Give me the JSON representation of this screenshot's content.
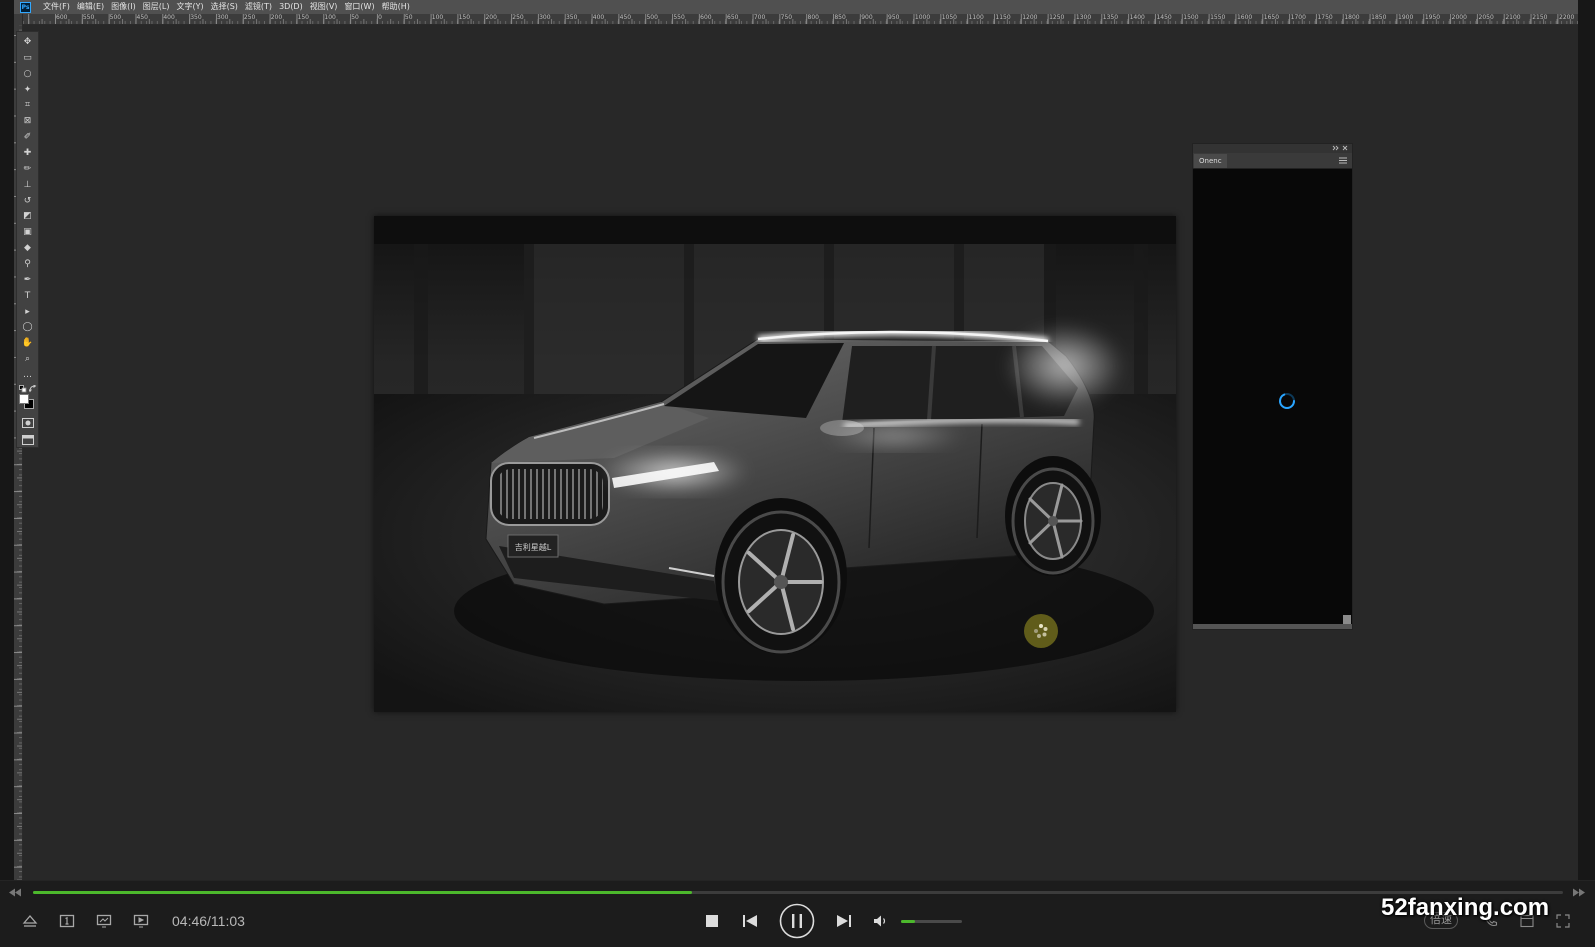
{
  "menu": {
    "logo": "Ps",
    "items": [
      "文件(F)",
      "编辑(E)",
      "图像(I)",
      "图层(L)",
      "文字(Y)",
      "选择(S)",
      "滤镜(T)",
      "3D(D)",
      "视图(V)",
      "窗口(W)",
      "帮助(H)"
    ]
  },
  "ruler": {
    "labels": [
      "600",
      "550",
      "500",
      "450",
      "400",
      "350",
      "300",
      "250",
      "200",
      "150",
      "100",
      "50",
      "0",
      "50",
      "100",
      "150",
      "200",
      "250",
      "300",
      "350",
      "400",
      "450",
      "500",
      "550",
      "600",
      "650",
      "700",
      "750",
      "800",
      "850",
      "900",
      "950",
      "1000",
      "1050",
      "1100",
      "1150",
      "1200",
      "1250",
      "1300",
      "1350",
      "1400",
      "1450",
      "1500",
      "1550",
      "1600",
      "1650",
      "1700",
      "1750",
      "1800",
      "1850",
      "1900",
      "1950",
      "2000",
      "2050",
      "2100",
      "2150",
      "2200"
    ]
  },
  "toolbar": {
    "tools": [
      "move",
      "rectangular-marquee",
      "lasso",
      "magic-wand",
      "crop",
      "frame",
      "eyedropper",
      "healing-brush",
      "brush",
      "clone-stamp",
      "history-brush",
      "eraser",
      "gradient",
      "blur",
      "dodge",
      "pen",
      "type",
      "path-selection",
      "ellipse",
      "hand",
      "zoom",
      "more"
    ],
    "foreground_color": "#ffffff",
    "background_color": "#000000"
  },
  "canvas": {
    "plate_text": "吉利星越L"
  },
  "panel": {
    "tab_label": "Onenc",
    "spinner_color": "#2aa5ff"
  },
  "player": {
    "time": "04:46/11:03",
    "progress_fraction": 0.431,
    "volume_fraction": 0.23,
    "speed_label": "倍速",
    "accent_color": "#4cb82c"
  },
  "watermark": {
    "text": "52fanxing.com"
  }
}
